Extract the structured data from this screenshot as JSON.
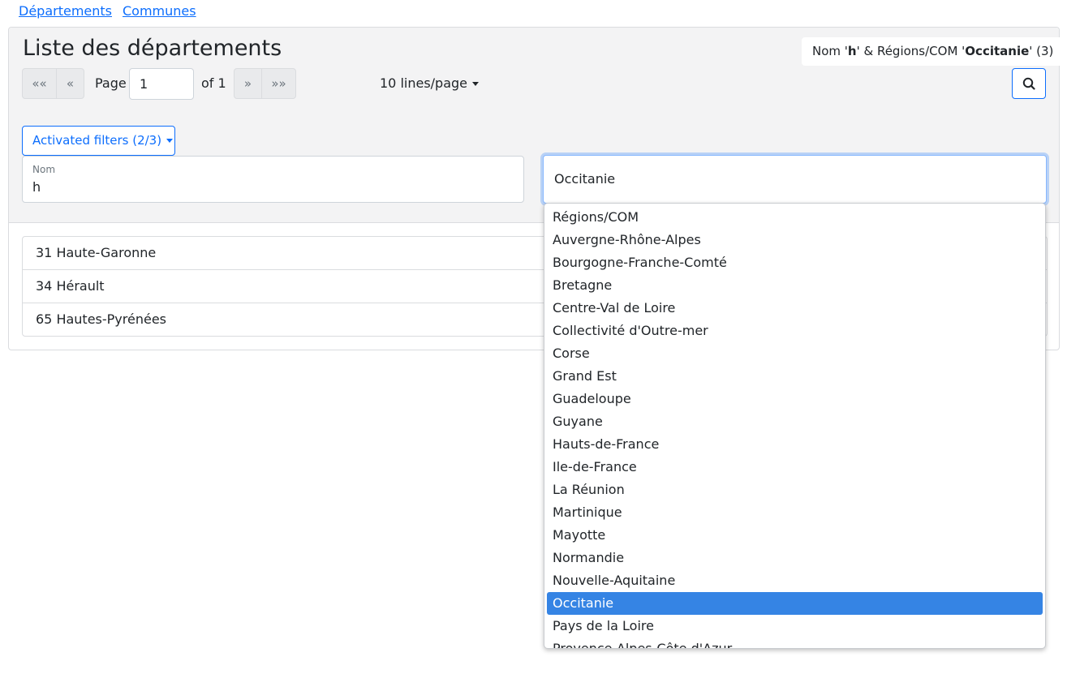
{
  "nav": {
    "departements": "Départements",
    "communes": "Communes"
  },
  "header": {
    "title": "Liste des départements",
    "summary": {
      "p1": "Nom '",
      "v1": "h",
      "p2": "' & Régions/COM '",
      "v2": "Occitanie",
      "p3": "' (3)"
    }
  },
  "pager": {
    "first": "««",
    "prev": "«",
    "page_label": "Page",
    "page_value": "1",
    "of_label": "of 1",
    "next": "»",
    "last": "»»",
    "lines_per_page": "10 lines/page"
  },
  "filters": {
    "toggle_label": "Activated filters (2/3)",
    "nom_label": "Nom",
    "nom_value": "h",
    "region_value": "Occitanie"
  },
  "results": [
    "31 Haute-Garonne",
    "34 Hérault",
    "65 Hautes-Pyrénées"
  ],
  "dropdown": {
    "options": [
      "Régions/COM",
      "Auvergne-Rhône-Alpes",
      "Bourgogne-Franche-Comté",
      "Bretagne",
      "Centre-Val de Loire",
      "Collectivité d'Outre-mer",
      "Corse",
      "Grand Est",
      "Guadeloupe",
      "Guyane",
      "Hauts-de-France",
      "Ile-de-France",
      "La Réunion",
      "Martinique",
      "Mayotte",
      "Normandie",
      "Nouvelle-Aquitaine",
      "Occitanie",
      "Pays de la Loire",
      "Provence-Alpes-Côte d'Azur"
    ],
    "selected": "Occitanie"
  },
  "icons": {
    "search": "search-icon"
  },
  "colors": {
    "accent": "#0d6efd",
    "selected_option": "#3584e4"
  }
}
